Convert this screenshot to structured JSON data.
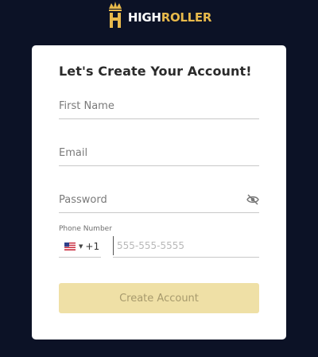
{
  "brand": {
    "name_part1": "HIGH",
    "name_part2": "ROLLER"
  },
  "form": {
    "title": "Let's Create Your Account!",
    "first_name": {
      "placeholder": "First Name",
      "value": ""
    },
    "email": {
      "placeholder": "Email",
      "value": ""
    },
    "password": {
      "placeholder": "Password",
      "value": ""
    },
    "phone": {
      "label": "Phone Number",
      "country_code": "+1",
      "country_flag": "us-flag-icon",
      "placeholder": "555-555-5555",
      "value": ""
    },
    "submit_label": "Create Account"
  },
  "colors": {
    "background": "#0c1226",
    "card": "#ffffff",
    "brand_gold": "#e7b94b",
    "button_disabled": "#efe0a6"
  }
}
